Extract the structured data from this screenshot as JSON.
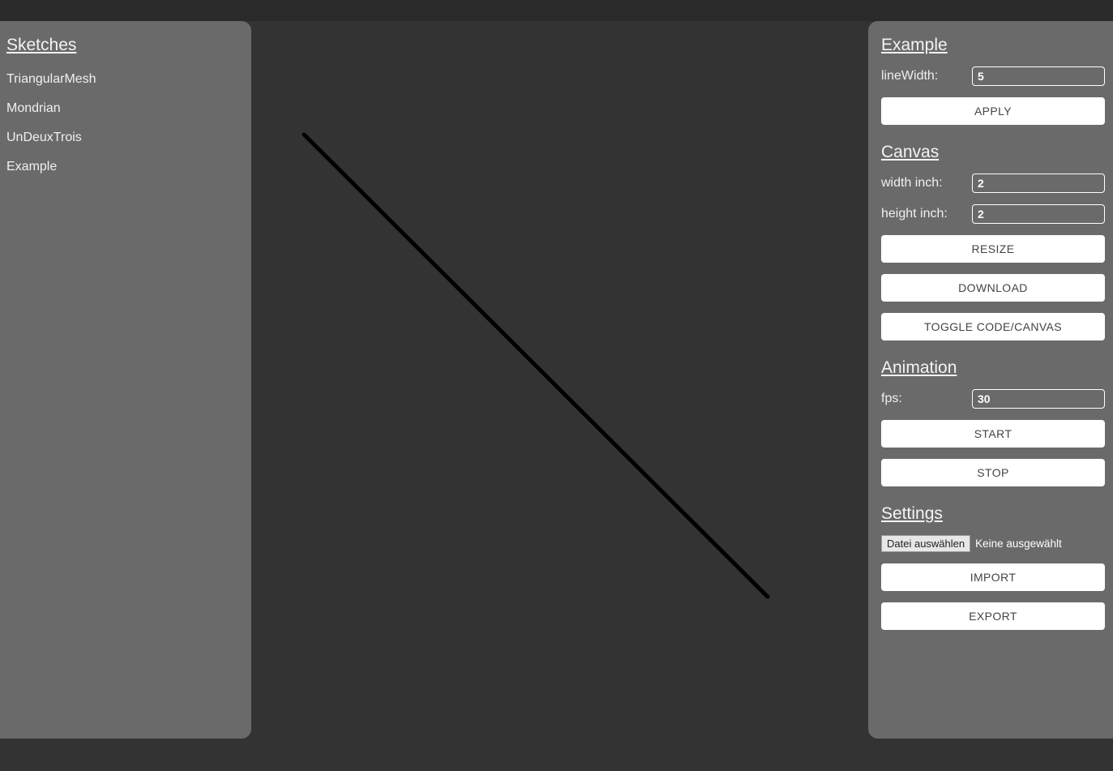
{
  "sidebar": {
    "title": "Sketches",
    "items": [
      "TriangularMesh",
      "Mondrian",
      "UnDeuxTrois",
      "Example"
    ]
  },
  "panel": {
    "example": {
      "title": "Example",
      "lineWidthLabel": "lineWidth:",
      "lineWidthValue": "5",
      "applyLabel": "APPLY"
    },
    "canvas": {
      "title": "Canvas",
      "widthLabel": "width inch:",
      "widthValue": "2",
      "heightLabel": "height inch:",
      "heightValue": "2",
      "resizeLabel": "RESIZE",
      "downloadLabel": "DOWNLOAD",
      "toggleLabel": "TOGGLE CODE/CANVAS"
    },
    "animation": {
      "title": "Animation",
      "fpsLabel": "fps:",
      "fpsValue": "30",
      "startLabel": "START",
      "stopLabel": "STOP"
    },
    "settings": {
      "title": "Settings",
      "fileBtnLabel": "Datei auswählen",
      "fileStatus": "Keine ausgewählt",
      "importLabel": "IMPORT",
      "exportLabel": "EXPORT"
    }
  }
}
